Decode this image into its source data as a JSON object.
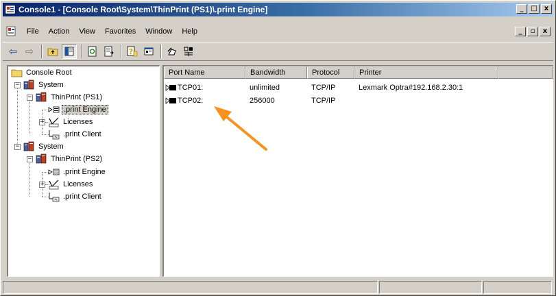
{
  "window": {
    "title": "Console1 - [Console Root\\System\\ThinPrint (PS1)\\.print Engine]",
    "caption_buttons": {
      "minimize": "_",
      "maximize": "□",
      "close": "x"
    }
  },
  "menubar": {
    "items": [
      {
        "label": "File"
      },
      {
        "label": "Action"
      },
      {
        "label": "View"
      },
      {
        "label": "Favorites"
      },
      {
        "label": "Window"
      },
      {
        "label": "Help"
      }
    ],
    "child_buttons": {
      "minimize": "_",
      "restore": "▫",
      "close": "x"
    }
  },
  "toolbar": {
    "buttons": [
      {
        "icon": "back-arrow-icon",
        "glyph": "⇦"
      },
      {
        "icon": "forward-arrow-icon",
        "glyph": "⇨"
      },
      {
        "icon": "up-folder-icon"
      },
      {
        "icon": "show-hide-tree-icon"
      },
      {
        "icon": "refresh-icon"
      },
      {
        "icon": "export-list-icon"
      },
      {
        "icon": "help-icon"
      },
      {
        "icon": "properties-icon"
      },
      {
        "icon": "tool-a-icon"
      },
      {
        "icon": "tool-b-icon"
      }
    ]
  },
  "tree": {
    "root": {
      "label": "Console Root"
    },
    "nodes": [
      {
        "label": "System",
        "expander": "−",
        "icon": "server-icon"
      },
      {
        "label": "ThinPrint (PS1)",
        "expander": "−",
        "icon": "thinprint-icon"
      },
      {
        "label": ".print Engine",
        "icon": "print-engine-icon",
        "selected": true
      },
      {
        "label": "Licenses",
        "expander": "+",
        "icon": "licenses-icon"
      },
      {
        "label": ".print Client",
        "icon": "print-client-icon"
      },
      {
        "label": "System",
        "expander": "−",
        "icon": "server-icon"
      },
      {
        "label": "ThinPrint (PS2)",
        "expander": "−",
        "icon": "thinprint-icon"
      },
      {
        "label": ".print Engine",
        "icon": "print-engine-icon"
      },
      {
        "label": "Licenses",
        "expander": "+",
        "icon": "licenses-icon"
      },
      {
        "label": ".print Client",
        "icon": "print-client-icon"
      }
    ]
  },
  "list": {
    "columns": [
      "Port Name",
      "Bandwidth",
      "Protocol",
      "Printer",
      ""
    ],
    "rows": [
      {
        "port": "TCP01:",
        "bandwidth": "unlimited",
        "protocol": "TCP/IP",
        "printer": "Lexmark Optra#192.168.2.30:1"
      },
      {
        "port": "TCP02:",
        "bandwidth": "256000",
        "protocol": "TCP/IP",
        "printer": ""
      }
    ]
  },
  "colors": {
    "titlebar_start": "#0a246a",
    "titlebar_end": "#a6caf0",
    "window_face": "#d4d0c8",
    "annotation_arrow": "#f7931e"
  }
}
